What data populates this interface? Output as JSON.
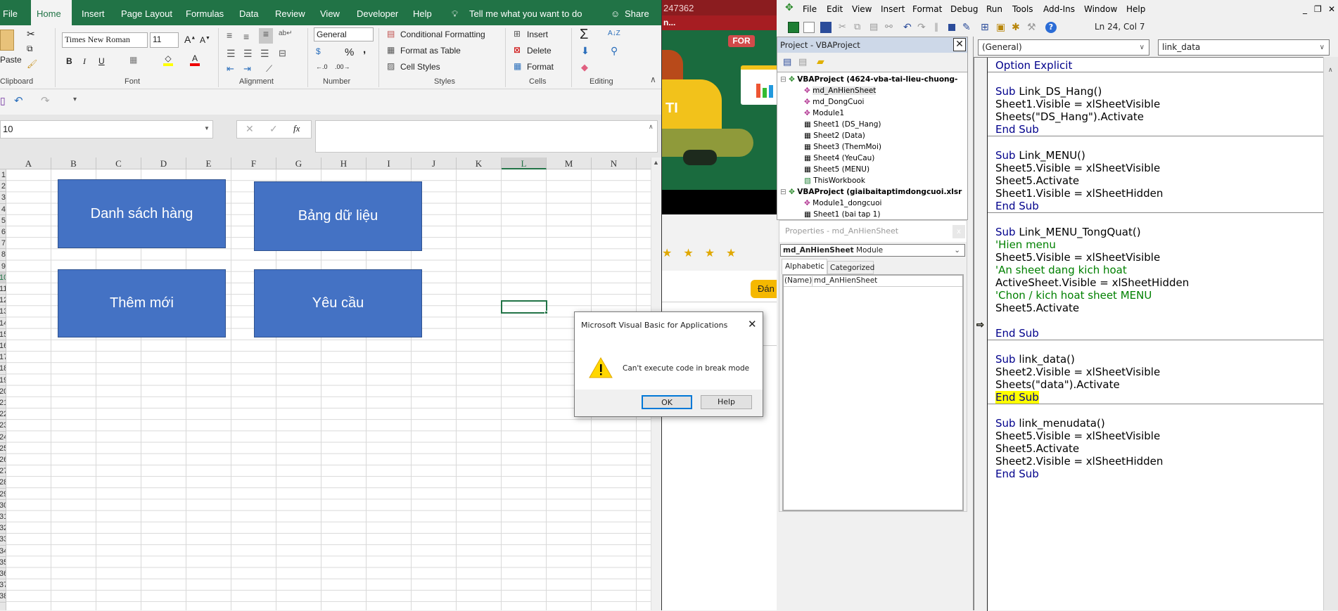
{
  "excel": {
    "tabs": [
      "File",
      "Home",
      "Insert",
      "Page Layout",
      "Formulas",
      "Data",
      "Review",
      "View",
      "Developer",
      "Help"
    ],
    "tell_me": "Tell me what you want to do",
    "share": "Share",
    "clipboard": {
      "paste": "Paste",
      "label": "Clipboard"
    },
    "font": {
      "name": "Times New Roman",
      "size": "11",
      "bold": "B",
      "italic": "I",
      "underline": "U",
      "label": "Font"
    },
    "alignment": {
      "label": "Alignment"
    },
    "number": {
      "format": "General",
      "percent": "%",
      "comma": ",",
      "label": "Number"
    },
    "styles": {
      "conditional": "Conditional Formatting",
      "table": "Format as Table",
      "cell_styles": "Cell Styles",
      "label": "Styles"
    },
    "cells": {
      "insert": "Insert",
      "delete": "Delete",
      "format": "Format",
      "label": "Cells"
    },
    "editing": {
      "sum": "Σ",
      "label": "Editing"
    },
    "name_box": "10",
    "fx": "fx",
    "formula": "",
    "columns": [
      "A",
      "B",
      "C",
      "D",
      "E",
      "F",
      "G",
      "H",
      "I",
      "J",
      "K",
      "L",
      "M",
      "N"
    ],
    "selected_column": "L",
    "rows": [
      "1",
      "2",
      "3",
      "4",
      "5",
      "6",
      "7",
      "8",
      "9",
      "10",
      "11",
      "12",
      "13",
      "14",
      "15",
      "16",
      "17",
      "18",
      "19",
      "20",
      "21",
      "22",
      "23",
      "24",
      "25",
      "26",
      "27",
      "28",
      "29",
      "30",
      "31",
      "32",
      "33",
      "34",
      "35",
      "36",
      "37",
      "38"
    ],
    "shapes": [
      "Danh sách hàng",
      "Bảng dữ liệu",
      "Thêm mới",
      "Yêu cầu"
    ]
  },
  "web": {
    "phone": "247362",
    "subtitle": "n...",
    "badge": "FOR",
    "shirt": "TI",
    "button": "Đán"
  },
  "dialog": {
    "title": "Microsoft Visual Basic for Applications",
    "message": "Can't execute code in break mode",
    "ok": "OK",
    "help": "Help",
    "warning_color": "#ffd700"
  },
  "vbe": {
    "menu": [
      "File",
      "Edit",
      "View",
      "Insert",
      "Format",
      "Debug",
      "Run",
      "Tools",
      "Add-Ins",
      "Window",
      "Help"
    ],
    "status": "Ln 24, Col 7",
    "project": {
      "title": "Project - VBAProject",
      "items": [
        {
          "label": "VBAProject (4624-vba-tai-lieu-chuong-",
          "level": 0,
          "icon": "vba-project-icon"
        },
        {
          "label": "md_AnHienSheet",
          "level": 1,
          "icon": "module-icon"
        },
        {
          "label": "md_DongCuoi",
          "level": 1,
          "icon": "module-icon"
        },
        {
          "label": "Module1",
          "level": 1,
          "icon": "module-icon"
        },
        {
          "label": "Sheet1 (DS_Hang)",
          "level": 1,
          "icon": "sheet-icon"
        },
        {
          "label": "Sheet2 (Data)",
          "level": 1,
          "icon": "sheet-icon"
        },
        {
          "label": "Sheet3 (ThemMoi)",
          "level": 1,
          "icon": "sheet-icon"
        },
        {
          "label": "Sheet4 (YeuCau)",
          "level": 1,
          "icon": "sheet-icon"
        },
        {
          "label": "Sheet5 (MENU)",
          "level": 1,
          "icon": "sheet-icon"
        },
        {
          "label": "ThisWorkbook",
          "level": 1,
          "icon": "workbook-icon"
        },
        {
          "label": "VBAProject (giaibaitaptimdongcuoi.xlsr",
          "level": 0,
          "icon": "vba-project-icon"
        },
        {
          "label": "Module1_dongcuoi",
          "level": 1,
          "icon": "module-icon"
        },
        {
          "label": "Sheet1 (bai tap 1)",
          "level": 1,
          "icon": "sheet-icon"
        }
      ]
    },
    "properties": {
      "title": "Properties - md_AnHienSheet",
      "object_name": "md_AnHienSheet",
      "object_type": "Module",
      "tabs": [
        "Alphabetic",
        "Categorized"
      ],
      "rows": [
        {
          "name": "(Name)",
          "value": "md_AnHienSheet"
        }
      ]
    },
    "code": {
      "object": "(General)",
      "procedure": "link_data",
      "blocks": [
        {
          "lines": [
            {
              "s": [
                [
                  "kw",
                  "Option Explicit"
                ]
              ]
            }
          ]
        },
        {
          "lines": [
            {
              "s": []
            },
            {
              "s": [
                [
                  "kw",
                  "Sub"
                ],
                [
                  "tx",
                  " Link_DS_Hang()"
                ]
              ]
            },
            {
              "s": [
                [
                  "tx",
                  "Sheet1.Visible = xlSheetVisible"
                ]
              ]
            },
            {
              "s": [
                [
                  "tx",
                  "Sheets(\"DS_Hang\").Activate"
                ]
              ]
            },
            {
              "s": [
                [
                  "kw",
                  "End Sub"
                ]
              ]
            }
          ]
        },
        {
          "lines": [
            {
              "s": []
            },
            {
              "s": [
                [
                  "kw",
                  "Sub"
                ],
                [
                  "tx",
                  " Link_MENU()"
                ]
              ]
            },
            {
              "s": [
                [
                  "tx",
                  "Sheet5.Visible = xlSheetVisible"
                ]
              ]
            },
            {
              "s": [
                [
                  "tx",
                  "Sheet5.Activate"
                ]
              ]
            },
            {
              "s": [
                [
                  "tx",
                  "Sheet1.Visible = xlSheetHidden"
                ]
              ]
            },
            {
              "s": [
                [
                  "kw",
                  "End Sub"
                ]
              ]
            }
          ]
        },
        {
          "lines": [
            {
              "s": []
            },
            {
              "s": [
                [
                  "kw",
                  "Sub"
                ],
                [
                  "tx",
                  " Link_MENU_TongQuat()"
                ]
              ]
            },
            {
              "s": [
                [
                  "cm",
                  "'Hien menu"
                ]
              ]
            },
            {
              "s": [
                [
                  "tx",
                  "Sheet5.Visible = xlSheetVisible"
                ]
              ]
            },
            {
              "s": [
                [
                  "cm",
                  "'An sheet dang kich hoat"
                ]
              ]
            },
            {
              "s": [
                [
                  "tx",
                  "ActiveSheet.Visible = xlSheetHidden"
                ]
              ]
            },
            {
              "s": [
                [
                  "cm",
                  "'Chon / kich hoat sheet MENU"
                ]
              ]
            },
            {
              "s": [
                [
                  "tx",
                  "Sheet5.Activate"
                ]
              ]
            },
            {
              "s": []
            },
            {
              "s": [
                [
                  "kw",
                  "End Sub"
                ]
              ]
            }
          ]
        },
        {
          "lines": [
            {
              "s": []
            },
            {
              "s": [
                [
                  "kw",
                  "Sub"
                ],
                [
                  "tx",
                  " link_data()"
                ]
              ]
            },
            {
              "s": [
                [
                  "tx",
                  "Sheet2.Visible = xlSheetVisible"
                ]
              ]
            },
            {
              "s": [
                [
                  "tx",
                  "Sheets(\"data\").Activate"
                ]
              ]
            },
            {
              "s": [
                [
                  "kw",
                  "End Sub"
                ]
              ],
              "current": true
            }
          ]
        },
        {
          "lines": [
            {
              "s": []
            },
            {
              "s": [
                [
                  "kw",
                  "Sub"
                ],
                [
                  "tx",
                  " link_menudata()"
                ]
              ]
            },
            {
              "s": [
                [
                  "tx",
                  "Sheet5.Visible = xlSheetVisible"
                ]
              ]
            },
            {
              "s": [
                [
                  "tx",
                  "Sheet5.Activate"
                ]
              ]
            },
            {
              "s": [
                [
                  "tx",
                  "Sheet2.Visible = xlSheetHidden"
                ]
              ]
            },
            {
              "s": [
                [
                  "kw",
                  "End Sub"
                ]
              ]
            }
          ]
        }
      ]
    }
  }
}
